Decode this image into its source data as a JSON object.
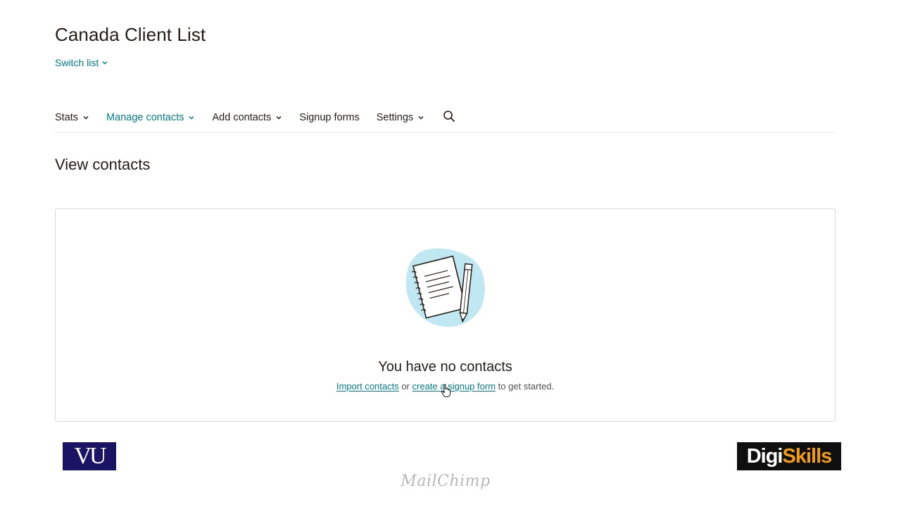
{
  "header": {
    "title": "Canada Client List",
    "switch_list_label": "Switch list"
  },
  "nav": {
    "items": [
      {
        "label": "Stats",
        "has_dropdown": true,
        "active": false
      },
      {
        "label": "Manage contacts",
        "has_dropdown": true,
        "active": true
      },
      {
        "label": "Add contacts",
        "has_dropdown": true,
        "active": false
      },
      {
        "label": "Signup forms",
        "has_dropdown": false,
        "active": false
      },
      {
        "label": "Settings",
        "has_dropdown": true,
        "active": false
      }
    ],
    "search_icon": "search-icon"
  },
  "section": {
    "title": "View contacts"
  },
  "empty_state": {
    "illustration": "notepad-pencil-illustration",
    "title": "You have no contacts",
    "import_link": "Import contacts",
    "or_text": " or ",
    "signup_link": "create a signup form",
    "suffix_text": " to get started."
  },
  "watermarks": {
    "vu_logo": "VU",
    "mailchimp_logo": "MailChimp",
    "digiskills_logo_white": "Digi",
    "digiskills_logo_orange": "Skills"
  },
  "colors": {
    "accent": "#007c89",
    "text": "#241c15",
    "border": "#d9d9d9",
    "illustration_blob": "#bfe8f3"
  }
}
